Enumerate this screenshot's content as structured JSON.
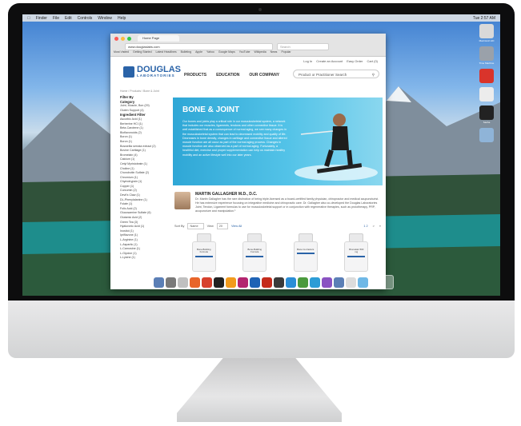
{
  "desktop": {
    "menubar": [
      "Finder",
      "File",
      "Edit",
      "Controls",
      "Window",
      "Help"
    ],
    "menubar_right": "Tue 2:57 AM",
    "dock_colors": [
      "#5b7fb6",
      "#7a7a7a",
      "#c0c0c0",
      "#e8652a",
      "#d6412d",
      "#222222",
      "#f29b1d",
      "#b3256f",
      "#1f63b5",
      "#c42b1c",
      "#3a3a3a",
      "#2b8ed6",
      "#4b9a3d",
      "#2c9cd6",
      "#8a53c2",
      "#5b7fb6",
      "#dcdcdc",
      "#6fb8e6"
    ],
    "icons": [
      {
        "label": "Macintosh HD",
        "color": "#d9d9d9"
      },
      {
        "label": "Time Machine",
        "color": "#9aa1aa"
      },
      {
        "label": "",
        "color": "#d9342b"
      },
      {
        "label": "",
        "color": "#ececec"
      },
      {
        "label": "Sasha",
        "color": "#222222"
      },
      {
        "label": "",
        "color": "#8fb4d8"
      }
    ]
  },
  "browser": {
    "tab_title": "Home Page",
    "url": "www.douglaslabs.com",
    "search_placeholder": "Search",
    "bookmarks": [
      "Most Visited",
      "Getting Started",
      "Latest Headlines",
      "Bulleting",
      "Apple",
      "Yahoo",
      "Google Maps",
      "YouTube",
      "Wikipedia",
      "News",
      "Popular"
    ]
  },
  "site": {
    "top_links": [
      "Log In",
      "Create an Account",
      "Easy Order",
      "Cart (0)"
    ],
    "logo_line1": "DOUGLAS",
    "logo_line2": "LABORATORIES",
    "nav": [
      "PRODUCTS",
      "EDUCATION",
      "OUR COMPANY"
    ],
    "product_search": "Product or Practitioner Search",
    "breadcrumb": "Home / Products / Bone & Joint",
    "sidebar": {
      "filter_by": "Filter By",
      "category": "Category",
      "category_items": [
        "Joint, Muscle, Bon (29)",
        "Gluten Support (4)"
      ],
      "ingredient": "Ingredient Filter",
      "ingredient_items": [
        "Ascorbic Acid (1)",
        "Berberine HCl (1)",
        "Beta-Carotene (1)",
        "Bioflavonoids (2)",
        "Boron (1)",
        "Boron (1)",
        "Boswellia serrata extract (2)",
        "Bovine Cartilage (1)",
        "Bromelain (4)",
        "Calcium (1)",
        "Cetyl Myristoleate (1)",
        "Choline (1)",
        "Chondroitin Sulfate (2)",
        "Chromium (1)",
        "Chymotrypsin (1)",
        "Copper (1)",
        "Curcumin (2)",
        "Devil's Claw (1)",
        "DL-Phenylalanine (1)",
        "Folate (1)",
        "Folic Acid (2)",
        "Glucosamine Sulfate (6)",
        "Glutamic Acid (2)",
        "Green Tea (3)",
        "Hyaluronic Acid (1)",
        "Inositol (1)",
        "Ipriflavone (1)",
        "L-Arginine (1)",
        "L-Aspartic (1)",
        "L-Carnosine (1)",
        "L-Glycine (1)",
        "L-Lysine (1)"
      ]
    },
    "hero_title": "BONE & JOINT",
    "hero_text": "Our bones and joints play a critical role in our musculoskeletal system, a network that includes our muscles, ligaments, tendons and other connective tissue. It is well established that as a consequence of normal aging, we see many changes in the musculoskeletal system that can lead to decreased mobility and quality of life. Decreases in bone density, changes in cartilage and connective tissue and altered muscle function are all occur as part of the normal aging process. Changes in muscle function are also observed as a part of normal aging. Fortunately, a healthful diet, exercise and proper supplementation can help us maintain healthy mobility and an active lifestyle well into our later years.",
    "author_name": "MARTIN GALLAGHER M.D., D.C.",
    "author_bio": "Dr. Martin Gallagher has the rare distinction of being triple-licensed as a board-certified family physician, chiropractor and medical acupuncturist. He has extensive experience focusing on integrative medicine and chiropractic care. Dr. Gallagher also co-developed the Douglas Laboratories Joint, Tendon, Ligament formulas to use for musculoskeletal support or in conjunction with regenerative therapies, such as prolotherapy, PRP, acupuncture and manipulation.¹",
    "sort_label": "Sort By",
    "sort_value": "Name",
    "view_label": "View",
    "view_value": "20",
    "view_all": "View All",
    "pager": [
      "1 2",
      ">",
      "»"
    ],
    "products": [
      "Bone-Building Formula",
      "Bone-Building Formula",
      "Bone Co-Factors",
      "Bromelain 500 mg"
    ]
  }
}
